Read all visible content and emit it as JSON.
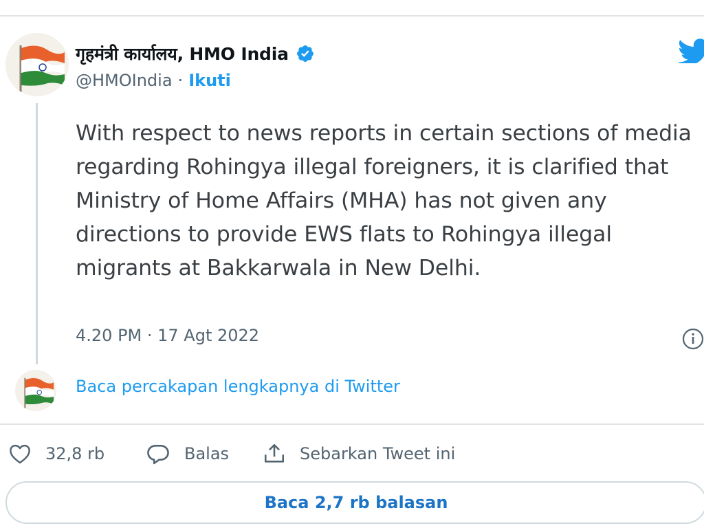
{
  "author": {
    "name": "गृहमंत्री कार्यालय, HMO India",
    "handle": "@HMOIndia",
    "separator": "·",
    "follow_label": "Ikuti",
    "verified": true
  },
  "tweet": {
    "text": "With respect to news reports in certain sections of media regarding Rohingya illegal foreigners, it is clarified that Ministry of Home Affairs (MHA) has not given any directions to provide EWS flats to Rohingya illegal migrants at Bakkarwala in New Delhi.",
    "timestamp": "4.20 PM · 17 Agt 2022"
  },
  "read_conversation_label": "Baca percakapan lengkapnya di Twitter",
  "actions": {
    "like_count": "32,8 rb",
    "reply_label": "Balas",
    "share_label": "Sebarkan Tweet ini"
  },
  "read_replies_label": "Baca 2,7 rb balasan",
  "icons": {
    "logo": "twitter-bird-icon",
    "verified": "verified-badge-icon",
    "info": "info-icon",
    "like": "heart-icon",
    "reply": "comment-icon",
    "share": "share-icon"
  },
  "colors": {
    "accent": "#1d9bf0",
    "text": "#0f1419",
    "muted": "#536471",
    "border": "#cfd9de",
    "flag_saffron": "#e8612c",
    "flag_green": "#2e8b3a"
  }
}
